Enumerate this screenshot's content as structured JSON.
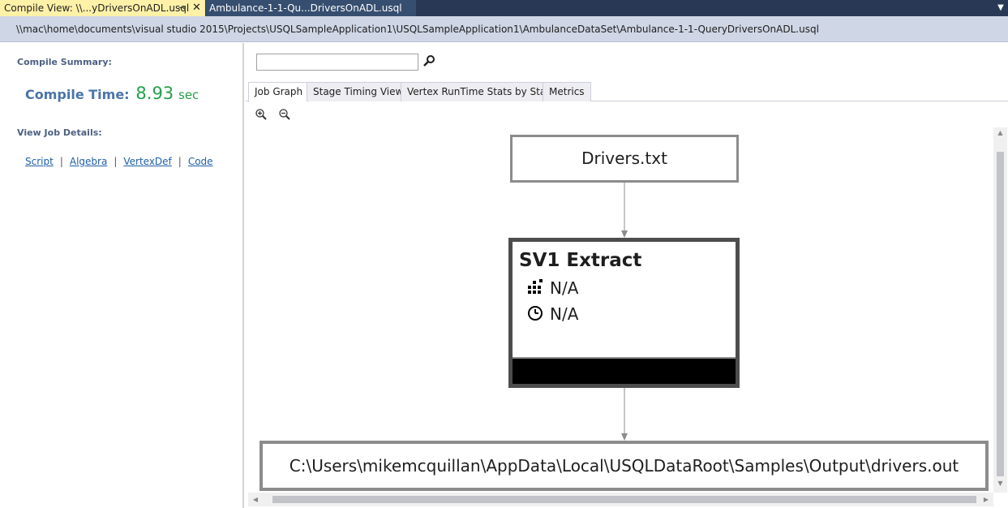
{
  "tabs": {
    "active_label": "Compile View:  \\\\...yDriversOnADL.usql",
    "inactive_label": "Ambulance-1-1-Qu...DriversOnADL.usql",
    "pin_glyph": "⊸",
    "close_glyph": "✕",
    "dropdown_glyph": "▼"
  },
  "path": "\\\\mac\\home\\documents\\visual studio 2015\\Projects\\USQLSampleApplication1\\USQLSampleApplication1\\AmbulanceDataSet\\Ambulance-1-1-QueryDriversOnADL.usql",
  "left_panel": {
    "summary_heading": "Compile Summary:",
    "compile_time_label": "Compile Time:",
    "compile_time_value": "8.93",
    "compile_time_unit": "sec",
    "details_heading": "View Job Details:",
    "links": [
      "Script",
      "Algebra",
      "VertexDef",
      "Code"
    ],
    "link_separator": "|"
  },
  "right_panel": {
    "search_value": "",
    "view_tabs": [
      "Job Graph",
      "Stage Timing View",
      "Vertex RunTime Stats by Stage",
      "Metrics"
    ],
    "selected_tab": "Job Graph"
  },
  "graph": {
    "input_node": "Drivers.txt",
    "stage": {
      "title": "SV1 Extract",
      "vertices": "N/A",
      "time": "N/A"
    },
    "output_node": "C:\\Users\\mikemcquillan\\AppData\\Local\\USQLDataRoot\\Samples\\Output\\drivers.out"
  },
  "colors": {
    "tab_bar": "#293955",
    "active_tab": "#fff1a8",
    "compile_time_label": "#4a74a8",
    "compile_time_value": "#21a24a",
    "link": "#1e5fa8"
  }
}
